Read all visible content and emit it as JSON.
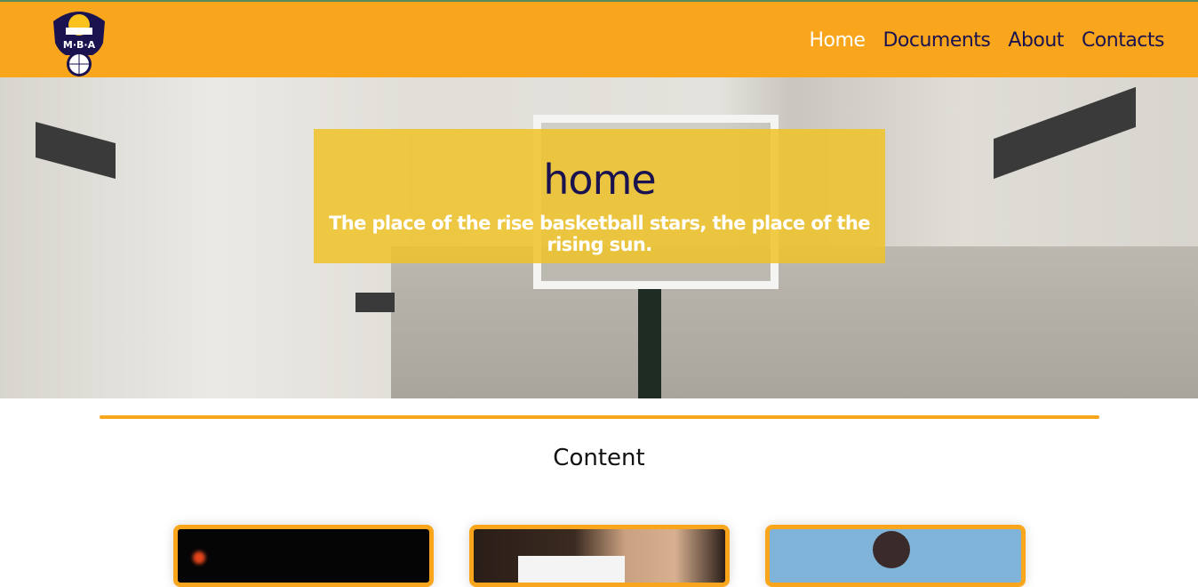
{
  "nav": {
    "logo_text": "M·B·A",
    "items": [
      {
        "label": "Home",
        "active": true
      },
      {
        "label": "Documents"
      },
      {
        "label": "About"
      },
      {
        "label": "Contacts"
      }
    ]
  },
  "hero": {
    "title": "home",
    "subtitle": "The place of the rise basketball stars, the place of the rising sun."
  },
  "content": {
    "heading": "Content",
    "cards": [
      {
        "image": "dark-basketball"
      },
      {
        "image": "player-dribbling"
      },
      {
        "image": "ball-in-sky"
      }
    ]
  },
  "colors": {
    "brand": "#f9a61c",
    "navy": "#1b1350"
  }
}
